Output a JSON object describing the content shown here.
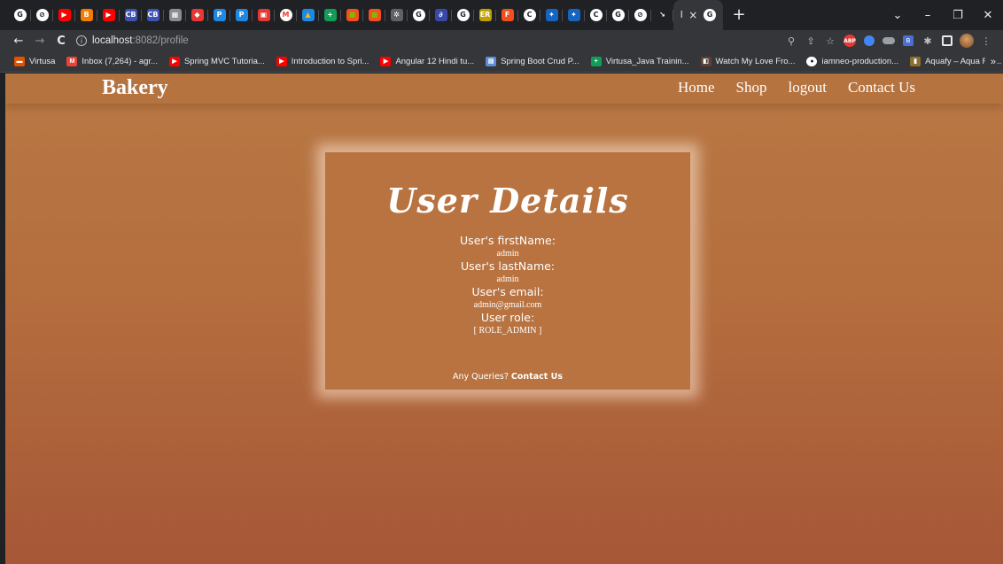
{
  "browser": {
    "tabs": [
      {
        "icon": "G",
        "color": "#ffffff",
        "fg": "#202124"
      },
      {
        "icon": "⊘",
        "color": "#ffffff",
        "fg": "#202124"
      },
      {
        "icon": "▶",
        "color": "#ff0000",
        "fg": "#ffffff"
      },
      {
        "icon": "B",
        "color": "#f57c00",
        "fg": "#ffffff"
      },
      {
        "icon": "▶",
        "color": "#ff0000",
        "fg": "#ffffff"
      },
      {
        "icon": "CB",
        "color": "#3f51b5",
        "fg": "#ffffff"
      },
      {
        "icon": "CB",
        "color": "#3f51b5",
        "fg": "#ffffff"
      },
      {
        "icon": "▦",
        "color": "#8d8d8d",
        "fg": "#ffffff"
      },
      {
        "icon": "◆",
        "color": "#e53935",
        "fg": "#ffffff"
      },
      {
        "icon": "P",
        "color": "#1e88e5",
        "fg": "#ffffff"
      },
      {
        "icon": "P",
        "color": "#1e88e5",
        "fg": "#ffffff"
      },
      {
        "icon": "▣",
        "color": "#e53935",
        "fg": "#ffffff"
      },
      {
        "icon": "M",
        "color": "#ffffff",
        "fg": "#ea4335"
      },
      {
        "icon": "▲",
        "color": "#1e88e5",
        "fg": "#fbbc04"
      },
      {
        "icon": "+",
        "color": "#0f9d58",
        "fg": "#ffffff"
      },
      {
        "icon": "■",
        "color": "#f25022",
        "fg": "#7fba00"
      },
      {
        "icon": "■",
        "color": "#f25022",
        "fg": "#7fba00"
      },
      {
        "icon": "✲",
        "color": "#5f6368",
        "fg": "#ffffff"
      },
      {
        "icon": "G",
        "color": "#ffffff",
        "fg": "#202124"
      },
      {
        "icon": "∂",
        "color": "#3949ab",
        "fg": "#ffffff"
      },
      {
        "icon": "G",
        "color": "#ffffff",
        "fg": "#202124"
      },
      {
        "icon": "ER",
        "color": "#c0a000",
        "fg": "#ffffff"
      },
      {
        "icon": "F",
        "color": "#f24e1e",
        "fg": "#ffffff"
      },
      {
        "icon": "C",
        "color": "#ffffff",
        "fg": "#202124"
      },
      {
        "icon": "✦",
        "color": "#1565c0",
        "fg": "#ffffff"
      },
      {
        "icon": "✦",
        "color": "#1565c0",
        "fg": "#ffffff"
      },
      {
        "icon": "C",
        "color": "#ffffff",
        "fg": "#202124"
      },
      {
        "icon": "G",
        "color": "#ffffff",
        "fg": "#202124"
      },
      {
        "icon": "⊘",
        "color": "#ffffff",
        "fg": "#202124"
      },
      {
        "icon": "↘",
        "color": "#202124",
        "fg": "#ffffff"
      }
    ],
    "active_tab": {
      "title": "l",
      "close": "×",
      "icon": "G"
    },
    "new_tab": "+",
    "window_controls": {
      "tabs_menu": "⌄",
      "minimize": "–",
      "restore": "❐",
      "close": "✕"
    },
    "nav": {
      "back": "←",
      "forward": "→",
      "reload": "C"
    },
    "address": {
      "info": "i",
      "host": "localhost",
      "path": ":8082/profile"
    },
    "toolbar_icons": {
      "zoom": "⚲",
      "share": "⇪",
      "bookmark": "☆",
      "abp": "ABP",
      "extension_b": "B",
      "puzzle": "✱",
      "more": "⋮"
    },
    "bookmarks": [
      {
        "label": "Virtusa",
        "icon": "▬",
        "color": "#e65100"
      },
      {
        "label": "Inbox (7,264) - agr...",
        "icon": "M",
        "color": "#ea4335"
      },
      {
        "label": "Spring MVC Tutoria...",
        "icon": "▶",
        "color": "#ff0000"
      },
      {
        "label": "Introduction to Spri...",
        "icon": "▶",
        "color": "#ff0000"
      },
      {
        "label": "Angular 12 Hindi tu...",
        "icon": "▶",
        "color": "#ff0000"
      },
      {
        "label": "Spring Boot Crud P...",
        "icon": "▤",
        "color": "#5c8dd6"
      },
      {
        "label": "Virtusa_Java Trainin...",
        "icon": "+",
        "color": "#0f9d58"
      },
      {
        "label": "Watch My Love Fro...",
        "icon": "◧",
        "color": "#5d4037"
      },
      {
        "label": "iamneo-production...",
        "icon": "●",
        "color": "#ffffff"
      },
      {
        "label": "Aquafy – Aqua Far...",
        "icon": "▮",
        "color": "#8d6e2f"
      }
    ],
    "bookmarks_more": "»"
  },
  "site": {
    "brand": "Bakery",
    "nav": [
      "Home",
      "Shop",
      "logout",
      "Contact Us"
    ]
  },
  "profile": {
    "title": "User Details",
    "fields": [
      {
        "label": "User's firstName:",
        "value": "admin"
      },
      {
        "label": "User's lastName:",
        "value": "admin"
      },
      {
        "label": "User's email:",
        "value": "admin@gmail.com"
      },
      {
        "label": "User role:",
        "value": "[ ROLE_ADMIN ]"
      }
    ],
    "footer_prefix": "Any Queries? ",
    "footer_link": "Contact Us"
  }
}
